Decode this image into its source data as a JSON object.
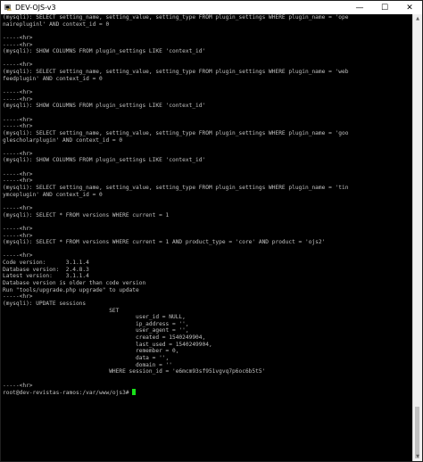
{
  "window": {
    "title": "DEV-OJS-v3",
    "minimize": "—",
    "maximize": "☐",
    "close": "✕"
  },
  "terminal": {
    "lines": [
      "(mysqli): SELECT setting_name, setting_value, setting_type FROM plugin_settings WHERE plugin_name = 'ope",
      "nairepluginl' AND context_id = 0",
      "",
      "-----<hr>",
      "-----<hr>",
      "(mysqli): SHOW COLUMNS FROM plugin_settings LIKE 'context_id'",
      "",
      "-----<hr>",
      "(mysqli): SELECT setting_name, setting_value, setting_type FROM plugin_settings WHERE plugin_name = 'web",
      "feedplugin' AND context_id = 0",
      "",
      "-----<hr>",
      "-----<hr>",
      "(mysqli): SHOW COLUMNS FROM plugin_settings LIKE 'context_id'",
      "",
      "-----<hr>",
      "-----<hr>",
      "(mysqli): SELECT setting_name, setting_value, setting_type FROM plugin_settings WHERE plugin_name = 'goo",
      "glescholarplugin' AND context_id = 0",
      "",
      "-----<hr>",
      "(mysqli): SHOW COLUMNS FROM plugin_settings LIKE 'context_id'",
      "",
      "-----<hr>",
      "-----<hr>",
      "(mysqli): SELECT setting_name, setting_value, setting_type FROM plugin_settings WHERE plugin_name = 'tin",
      "ymceplugin' AND context_id = 0",
      "",
      "-----<hr>",
      "(mysqli): SELECT * FROM versions WHERE current = 1",
      "",
      "-----<hr>",
      "-----<hr>",
      "(mysqli): SELECT * FROM versions WHERE current = 1 AND product_type = 'core' AND product = 'ojs2'",
      "",
      "-----<hr>",
      "Code version:      3.1.1.4",
      "Database version:  2.4.8.3",
      "Latest version:    3.1.1.4",
      "Database version is older than code version",
      "Run \"tools/upgrade.php upgrade\" to update",
      "-----<hr>",
      "(mysqli): UPDATE sessions",
      "                                SET",
      "                                        user_id = NULL,",
      "                                        ip_address = '',",
      "                                        user_agent = '',",
      "                                        created = 1540249904,",
      "                                        last_used = 1540249904,",
      "                                        remember = 0,",
      "                                        data = '',",
      "                                        domain = ''",
      "                                WHERE session_id = 'e6mcm93sf951vgvq7p6oc6b5t5'",
      "",
      "-----<hr>",
      "root@dev-revistas-ramos:/var/www/ojs3# "
    ],
    "cursor_color": "#19e219"
  }
}
